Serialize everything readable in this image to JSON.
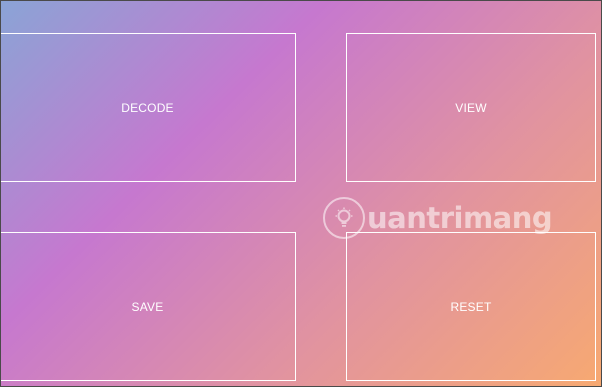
{
  "buttons": {
    "decode": "DECODE",
    "view": "VIEW",
    "save": "SAVE",
    "reset": "RESET"
  },
  "watermark": {
    "text": "uantrimang",
    "logo_icon": "lightbulb-icon"
  },
  "colors": {
    "gradient_start": "#8aa4d6",
    "gradient_mid1": "#c678cf",
    "gradient_mid2": "#e193a0",
    "gradient_end": "#f7a971",
    "border": "#ffffff",
    "text": "#ffffff"
  }
}
